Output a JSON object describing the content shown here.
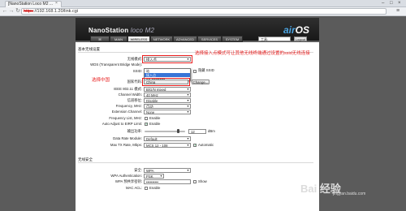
{
  "browser": {
    "tab_title": "[NanoStation Loco M2 ...",
    "tab_close": "×",
    "url_prefix": "https",
    "url_rest": "://192.168.1.20/link.cgi",
    "back": "←",
    "forward": "→",
    "reload": "↻",
    "menu": "≡",
    "min": "–",
    "max": "□",
    "close": "×"
  },
  "header": {
    "product": "NanoStation ",
    "model": "loco M2",
    "airos_air": "air",
    "airos_os": "OS"
  },
  "nav": {
    "tabs": [
      "",
      "MAIN",
      "WIRELESS",
      "NETWORK",
      "ADVANCED",
      "SERVICES",
      "SYSTEM"
    ],
    "tools_value": "工具:",
    "logout": "Logout"
  },
  "form": {
    "section_basic": "基本无线设置",
    "wireless_mode_label": "无线模式:",
    "wireless_mode_value": "接入点",
    "wds_label": "WDS (Transparent Bridge Mode):",
    "ssid_label": "SSID:",
    "hide_ssid": "隐藏 SSID",
    "country_label": "国家代码:",
    "country_value": "China",
    "change_btn": "Change...",
    "ieee_label": "IEEE 802.11 模式:",
    "ieee_value": "B/G/N mixed",
    "channel_width_label": "Channel Width:",
    "channel_width_value": "40 MHz",
    "channel_shift_label": "信道移位:",
    "channel_shift_value": "Disable",
    "frequency_label": "Frequency, MHz:",
    "frequency_value": "自动",
    "ext_channel_label": "Extension Channel:",
    "ext_channel_value": "None",
    "freq_list_label": "Frequency List, MHz:",
    "freq_list_enable": "Enable",
    "auto_eirp_label": "Auto Adjust to EIRP Limit:",
    "auto_eirp_enable": "Enable",
    "output_power_label": "输出功率:",
    "output_power_value": "12",
    "output_power_unit": "dBm",
    "data_rate_label": "Data Rate Module:",
    "data_rate_value": "Default",
    "max_tx_label": "Max TX Rate, Mbps:",
    "max_tx_value": "MCS 12 - 108",
    "automatic": "Automatic",
    "section_security": "无线安全",
    "security_label": "安全:",
    "security_value": "WPA",
    "wpa_auth_label": "WPA Authentication:",
    "wpa_auth_value": "PSK",
    "wpa_key_label": "WPA 预共享密钥:",
    "wpa_key_value": "••••••••••",
    "show": "Show",
    "mac_acl_label": "MAC ACL:",
    "mac_acl_enable": "Enable"
  },
  "dropdown": {
    "items": [
      "站",
      "接入点",
      "AP-Repeater"
    ],
    "highlighted_index": 1
  },
  "annotations": {
    "mode_note": "选择接入点模式可让其他无线终端通过设置的ssid无线连接",
    "country_note": "选择中国"
  },
  "watermark": {
    "text": "Bai 经验",
    "sub": "jingyan.baidu.com"
  },
  "colors": {
    "annotation_red": "#e81c1c",
    "dropdown_highlight": "#3875d7",
    "airos_blue": "#4ba3e0"
  }
}
